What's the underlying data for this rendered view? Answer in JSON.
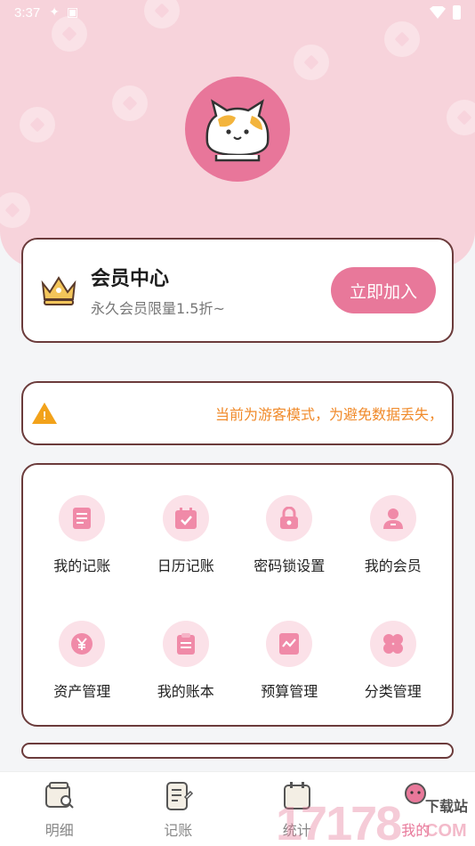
{
  "status_bar": {
    "time": "3:37"
  },
  "member": {
    "title": "会员中心",
    "subtitle": "永久会员限量1.5折~",
    "join_label": "立即加入"
  },
  "notice": {
    "text": "当前为游客模式，为避免数据丢失，"
  },
  "menu": [
    {
      "label": "我的记账",
      "icon": "document-icon"
    },
    {
      "label": "日历记账",
      "icon": "calendar-icon"
    },
    {
      "label": "密码锁设置",
      "icon": "lock-icon"
    },
    {
      "label": "我的会员",
      "icon": "user-icon"
    },
    {
      "label": "资产管理",
      "icon": "yen-coin-icon"
    },
    {
      "label": "我的账本",
      "icon": "clipboard-icon"
    },
    {
      "label": "预算管理",
      "icon": "chart-icon"
    },
    {
      "label": "分类管理",
      "icon": "clover-icon"
    }
  ],
  "bottom_nav": [
    {
      "label": "明细",
      "icon": "wallet-icon"
    },
    {
      "label": "记账",
      "icon": "notebook-icon"
    },
    {
      "label": "统计",
      "icon": "calendar-stats-icon"
    },
    {
      "label": "我的",
      "icon": "profile-icon"
    }
  ],
  "watermark": {
    "digits": "17178",
    "tag": "下载站",
    "domain": "COM"
  },
  "colors": {
    "pink": "#e8789a",
    "light_pink": "#fbe1e8",
    "hero": "#f7d3db",
    "border": "#6b3b3b",
    "warning": "#f08a2a"
  }
}
